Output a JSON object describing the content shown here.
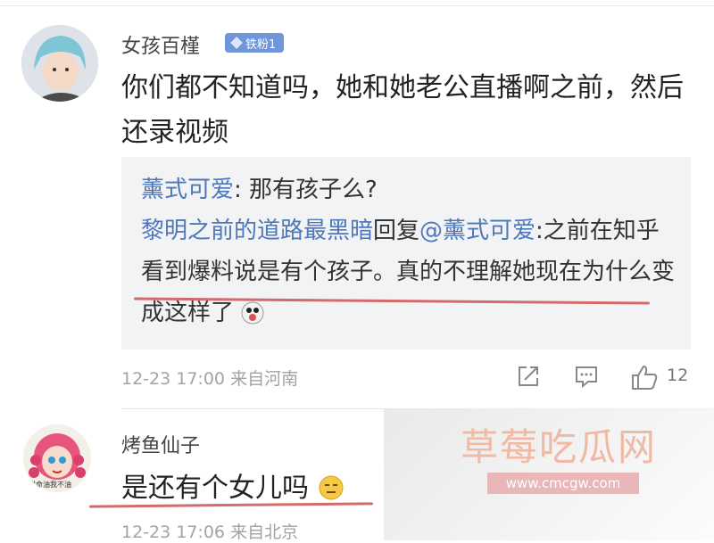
{
  "comment1": {
    "username": "女孩百槿",
    "badge": "铁粉1",
    "text": "你们都不知道吗，她和她老公直播啊之前，然后还录视频",
    "quote": {
      "user1": "薰式可爱",
      "line1": ": 那有孩子么?",
      "user2": "黎明之前的道路最黑暗",
      "reply_word": "回复",
      "mention": "@薰式可爱",
      "line2": ":之前在知乎看到爆料说是有个孩子。真的不理解她现在为什么变成这样了"
    },
    "time": "12-23 17:00",
    "location": "来自河南",
    "like_count": "12"
  },
  "comment2": {
    "username": "烤鱼仙子",
    "avatar_caption": "拼命油我不油",
    "text": "是还有个女儿吗",
    "time": "12-23 17:06",
    "location": "来自北京"
  },
  "watermark": {
    "title": "草莓吃瓜网",
    "url": "www.cmcgw.com"
  },
  "colors": {
    "link_blue": "#4f78b8",
    "badge_blue": "#6f96d8",
    "underline_red": "#d26b6b",
    "meta_gray": "#a3a3a3"
  },
  "icons": [
    "share-icon",
    "comment-icon",
    "like-icon",
    "smiley-icon",
    "emoji-surprised-icon"
  ]
}
